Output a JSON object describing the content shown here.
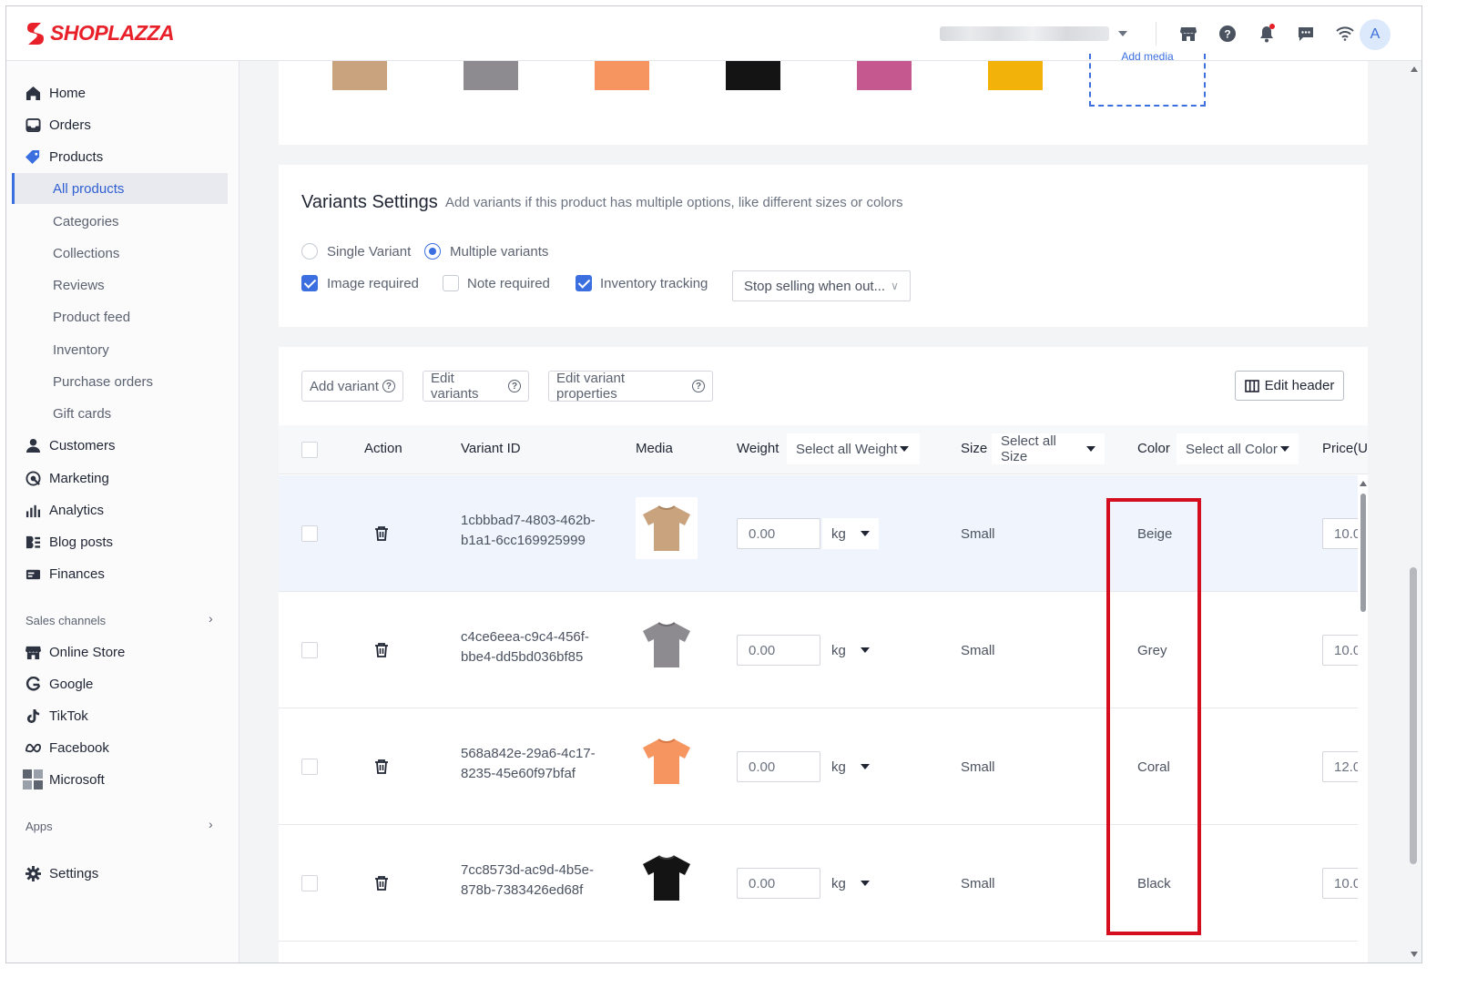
{
  "header": {
    "logo_text": "SHOPLAZZA",
    "avatar_initial": "A",
    "icons": [
      "store-icon",
      "help-icon",
      "bell-icon",
      "chat-icon",
      "wifi-icon"
    ]
  },
  "sidebar": {
    "nav": [
      {
        "label": "Home",
        "icon": "home-icon"
      },
      {
        "label": "Orders",
        "icon": "orders-icon"
      },
      {
        "label": "Products",
        "icon": "tag-icon"
      }
    ],
    "products_sub": [
      "All products",
      "Categories",
      "Collections",
      "Reviews",
      "Product feed",
      "Inventory",
      "Purchase orders",
      "Gift cards"
    ],
    "nav2": [
      {
        "label": "Customers",
        "icon": "person-icon"
      },
      {
        "label": "Marketing",
        "icon": "marketing-icon"
      },
      {
        "label": "Analytics",
        "icon": "analytics-icon"
      },
      {
        "label": "Blog posts",
        "icon": "blog-icon"
      },
      {
        "label": "Finances",
        "icon": "finances-icon"
      }
    ],
    "sales_channels_label": "Sales channels",
    "channels": [
      {
        "label": "Online Store",
        "icon": "store-icon"
      },
      {
        "label": "Google",
        "icon": "google-icon"
      },
      {
        "label": "TikTok",
        "icon": "tiktok-icon"
      },
      {
        "label": "Facebook",
        "icon": "meta-icon"
      },
      {
        "label": "Microsoft",
        "icon": "microsoft-icon"
      }
    ],
    "apps_label": "Apps",
    "settings_label": "Settings"
  },
  "media_strip": {
    "colors": [
      "#c9a37e",
      "#8d8b90",
      "#f6955f",
      "#141414",
      "#c5598f",
      "#f2b20a"
    ],
    "add_media_label": "Add media"
  },
  "variants_settings": {
    "title": "Variants Settings",
    "subtitle": "Add variants if this product has multiple options, like different sizes or colors",
    "single_variant_label": "Single Variant",
    "multiple_variants_label": "Multiple variants",
    "selected_mode": "Multiple variants",
    "image_required_label": "Image required",
    "image_required": true,
    "note_required_label": "Note required",
    "note_required": false,
    "inventory_tracking_label": "Inventory tracking",
    "inventory_tracking": true,
    "out_of_stock_select": "Stop selling when out..."
  },
  "toolbar": {
    "add_variant": "Add variant",
    "edit_variants": "Edit variants",
    "edit_variant_properties": "Edit variant properties",
    "edit_header": "Edit header"
  },
  "table": {
    "headers": {
      "action": "Action",
      "variant_id": "Variant ID",
      "media": "Media",
      "weight": "Weight",
      "weight_select": "Select all Weight",
      "size": "Size",
      "size_select": "Select all Size",
      "color": "Color",
      "color_select": "Select all Color",
      "price": "Price(U"
    },
    "rows": [
      {
        "id_line1": "1cbbbad7-4803-462b-",
        "id_line2": "b1a1-6cc169925999",
        "weight": "0.00",
        "unit": "kg",
        "size": "Small",
        "color": "Beige",
        "price": "10.0",
        "shirt_color": "#c9a37e"
      },
      {
        "id_line1": "c4ce6eea-c9c4-456f-",
        "id_line2": "bbe4-dd5bd036bf85",
        "weight": "0.00",
        "unit": "kg",
        "size": "Small",
        "color": "Grey",
        "price": "10.0",
        "shirt_color": "#8d8b90"
      },
      {
        "id_line1": "568a842e-29a6-4c17-",
        "id_line2": "8235-45e60f97bfaf",
        "weight": "0.00",
        "unit": "kg",
        "size": "Small",
        "color": "Coral",
        "price": "12.0",
        "shirt_color": "#f6955f"
      },
      {
        "id_line1": "7cc8573d-ac9d-4b5e-",
        "id_line2": "878b-7383426ed68f",
        "weight": "0.00",
        "unit": "kg",
        "size": "Small",
        "color": "Black",
        "price": "10.0",
        "shirt_color": "#141414"
      }
    ]
  }
}
